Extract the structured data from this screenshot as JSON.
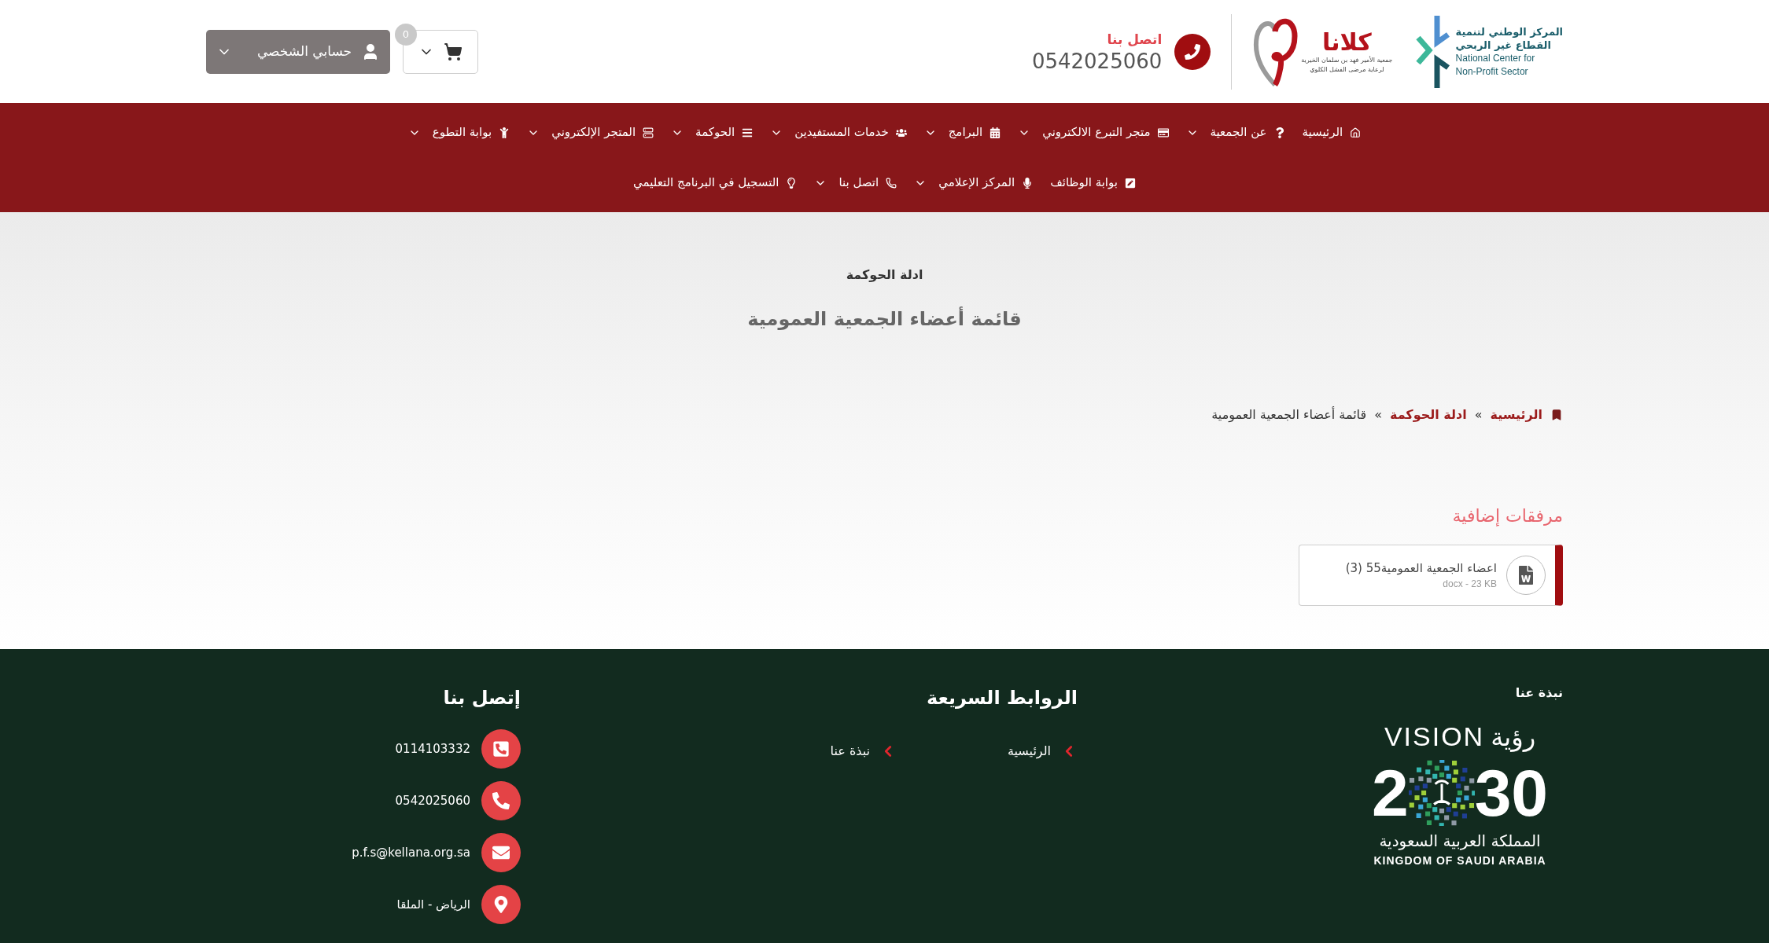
{
  "header": {
    "account_button": "حسابي الشخصي",
    "cart_count": "0",
    "contact": {
      "label": "اتصل بنا",
      "phone": "0542025060"
    },
    "kellana_logo": {
      "name": "كلانا",
      "line_1": "جمعية الأمير فهد بن سلمان الخيرية",
      "line_2": "لرعاية مرضى الفشل الكلوي"
    },
    "ncnp_logo": {
      "arabic_1": "المركز الوطني لتنمية",
      "arabic_2": "القطاع غير الربحي",
      "english_1": "National Center for",
      "english_2": "Non-Profit Sector"
    }
  },
  "nav": {
    "rows": [
      {
        "items": [
          {
            "label": "الرئيسية",
            "has_menu": false
          },
          {
            "label": "عن الجمعية",
            "has_menu": true
          },
          {
            "label": "متجر التبرع الالكتروني",
            "has_menu": true
          },
          {
            "label": "البرامج",
            "has_menu": true
          },
          {
            "label": "خدمات المستفيدين",
            "has_menu": true
          },
          {
            "label": "الحوكمة",
            "has_menu": true
          },
          {
            "label": "المتجر الإلكتروني",
            "has_menu": true
          },
          {
            "label": "بوابة التطوع",
            "has_menu": true
          }
        ]
      },
      {
        "items": [
          {
            "label": "بوابة الوظائف",
            "has_menu": false
          },
          {
            "label": "المركز الإعلامي",
            "has_menu": true
          },
          {
            "label": "اتصل بنا",
            "has_menu": true
          },
          {
            "label": "التسجيل في البرنامج التعليمي",
            "has_menu": false
          }
        ]
      }
    ]
  },
  "hero": {
    "section": "ادلة الحوكمة",
    "title": "قائمة أعضاء الجمعية العمومية"
  },
  "breadcrumb": {
    "separator": "»",
    "items": [
      {
        "label": "الرئيسية",
        "kind": "link"
      },
      {
        "label": "ادلة الحوكمة",
        "kind": "link"
      },
      {
        "label": "قائمة أعضاء الجمعية العمومية",
        "kind": "current"
      }
    ]
  },
  "attachments": {
    "title": "مرفقات إضافية",
    "files": [
      {
        "name": "اعضاء الجمعية العمومية55 (3)",
        "meta": "docx - 23 KB"
      }
    ]
  },
  "footer": {
    "about": {
      "title": "نبذة عنا",
      "vision_logo": {
        "arabic": "رؤية",
        "english": "VISION",
        "digit_1": "2",
        "digits_2": "30",
        "country_arabic": "المملكة العربية السعودية",
        "country_english": "KINGDOM OF SAUDI ARABIA"
      }
    },
    "quick_links": {
      "title": "الروابط السريعة",
      "links": [
        "الرئيسية",
        "نبذة عنا"
      ]
    },
    "contact": {
      "title": "إتصل بنا",
      "items": [
        {
          "kind": "landline",
          "text": "0114103332"
        },
        {
          "kind": "mobile",
          "text": "0542025060"
        },
        {
          "kind": "email",
          "text": "p.f.s@kellana.org.sa"
        },
        {
          "kind": "location",
          "text": "الرياض - الملقا"
        }
      ]
    }
  }
}
